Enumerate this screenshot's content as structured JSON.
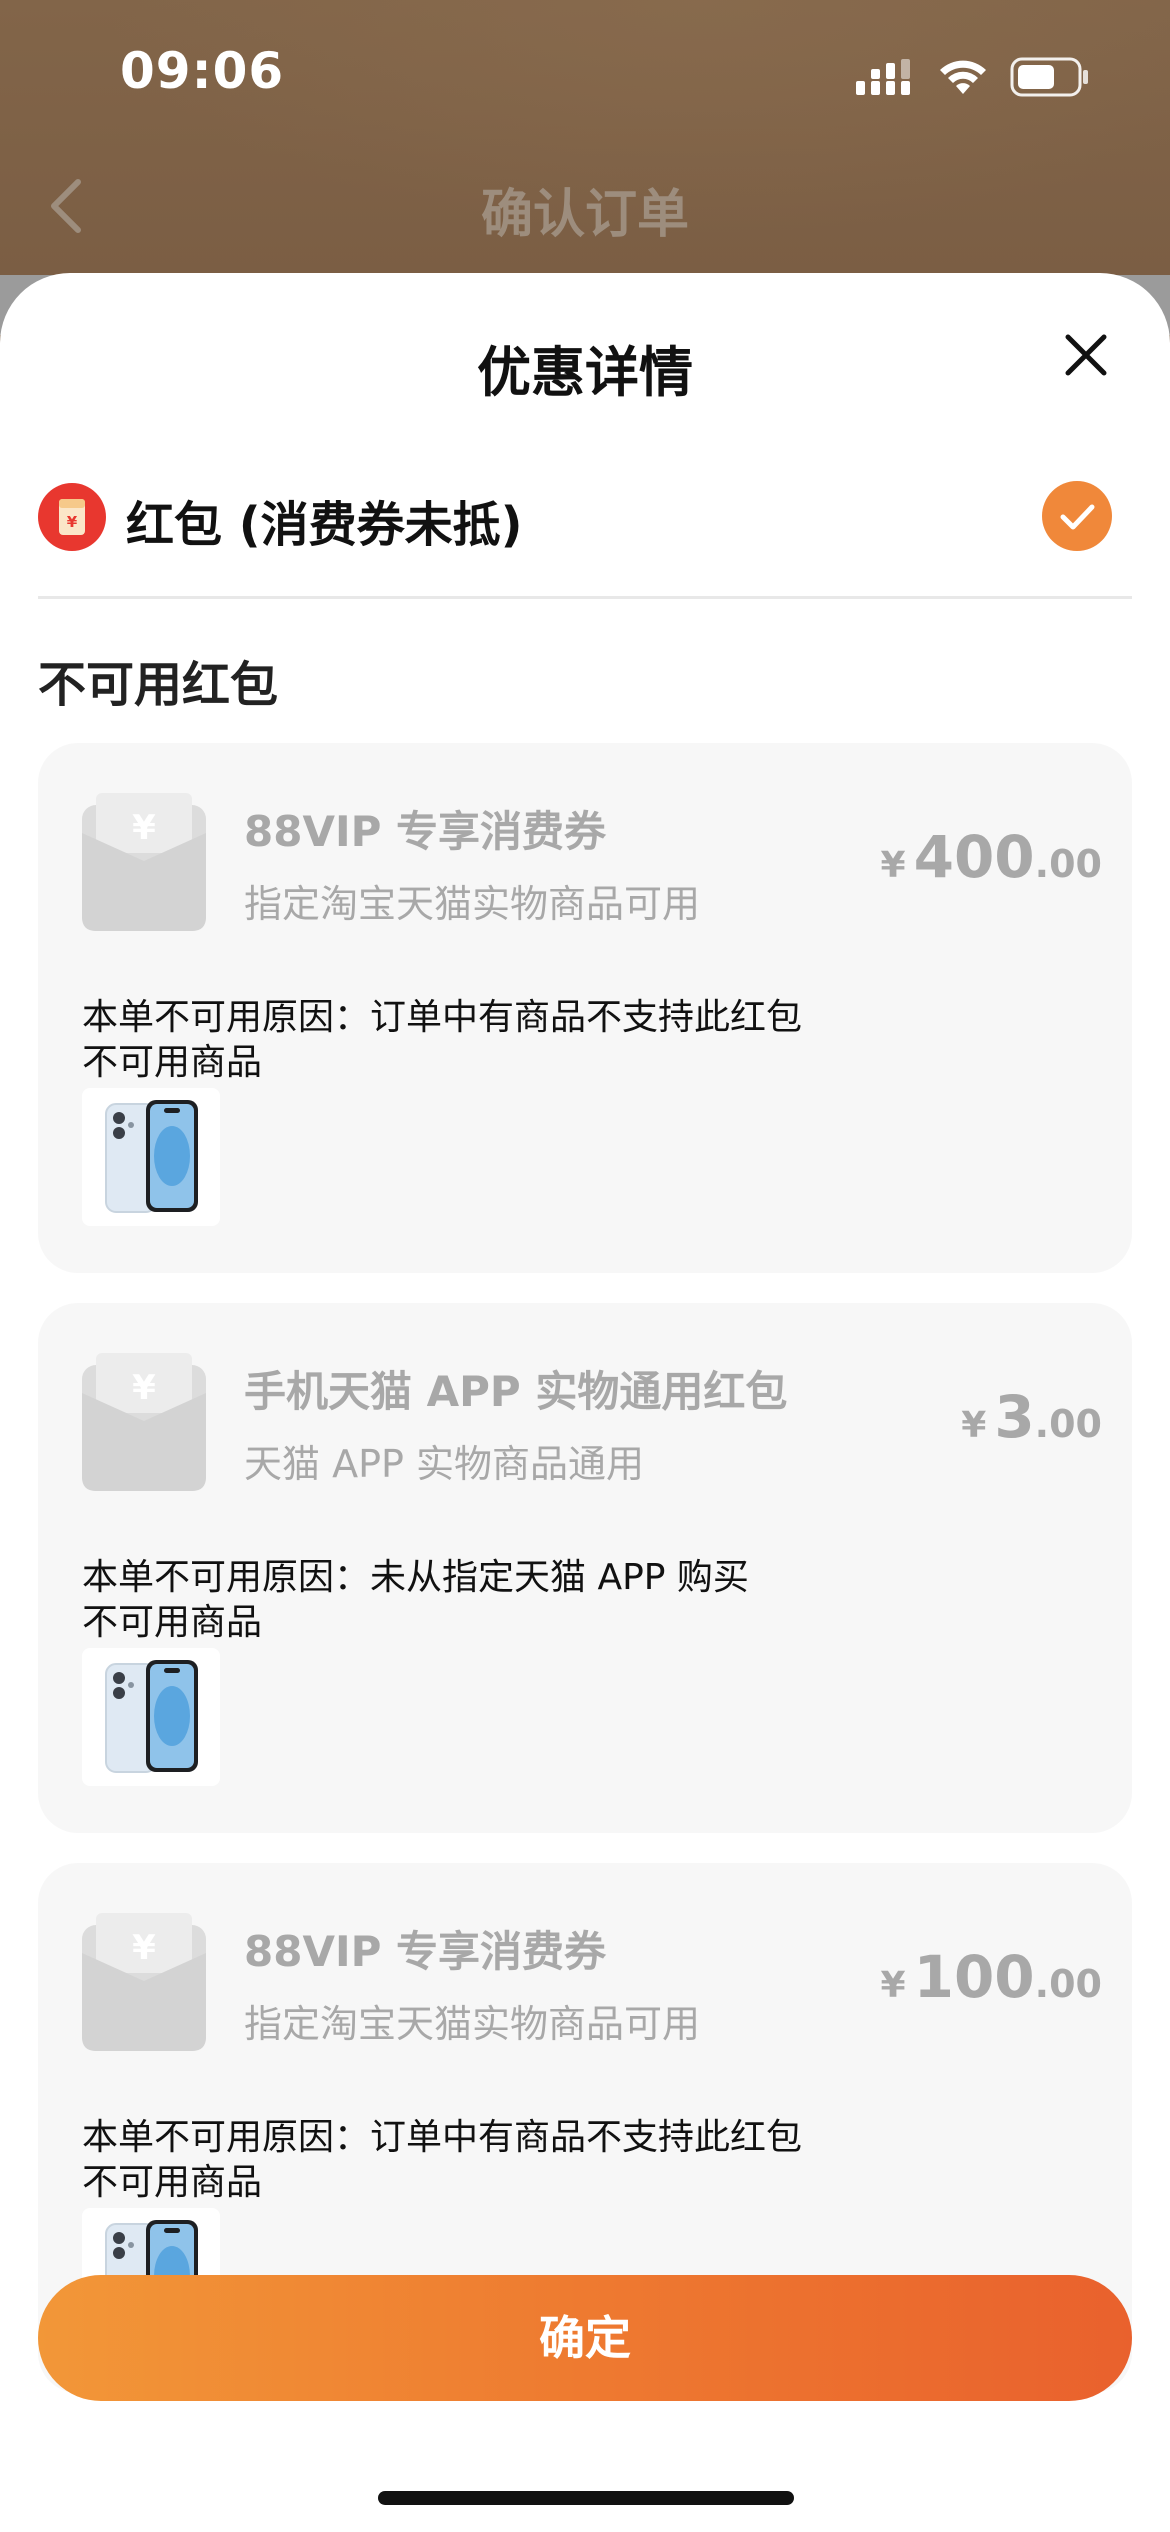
{
  "status_bar": {
    "time": "09:06"
  },
  "background_page": {
    "title": "确认订单"
  },
  "sheet": {
    "title": "优惠详情",
    "redpack_label": "红包 (消费券未抵)",
    "redpack_checked": true,
    "section_title": "不可用红包",
    "confirm_label": "确定"
  },
  "cards": [
    {
      "name": "88VIP 专享消费券",
      "desc": "指定淘宝天猫实物商品可用",
      "currency": "¥",
      "amount_int": "400",
      "amount_dec": ".00",
      "reason": "本单不可用原因：订单中有商品不支持此红包",
      "unavailable_label": "不可用商品",
      "product_icon": "iphone-icon"
    },
    {
      "name": "手机天猫 APP 实物通用红包",
      "desc": "天猫 APP 实物商品通用",
      "currency": "¥",
      "amount_int": "3",
      "amount_dec": ".00",
      "reason": "本单不可用原因：未从指定天猫 APP 购买",
      "unavailable_label": "不可用商品",
      "product_icon": "iphone-icon"
    },
    {
      "name": "88VIP 专享消费券",
      "desc": "指定淘宝天猫实物商品可用",
      "currency": "¥",
      "amount_int": "100",
      "amount_dec": ".00",
      "reason": "本单不可用原因：订单中有商品不支持此红包",
      "unavailable_label": "不可用商品",
      "product_icon": "iphone-icon"
    }
  ],
  "colors": {
    "accent_orange": "#F0883A",
    "muted_text": "#A8A8A8",
    "card_bg": "#F7F7F7",
    "redpack_red": "#E8372F"
  }
}
